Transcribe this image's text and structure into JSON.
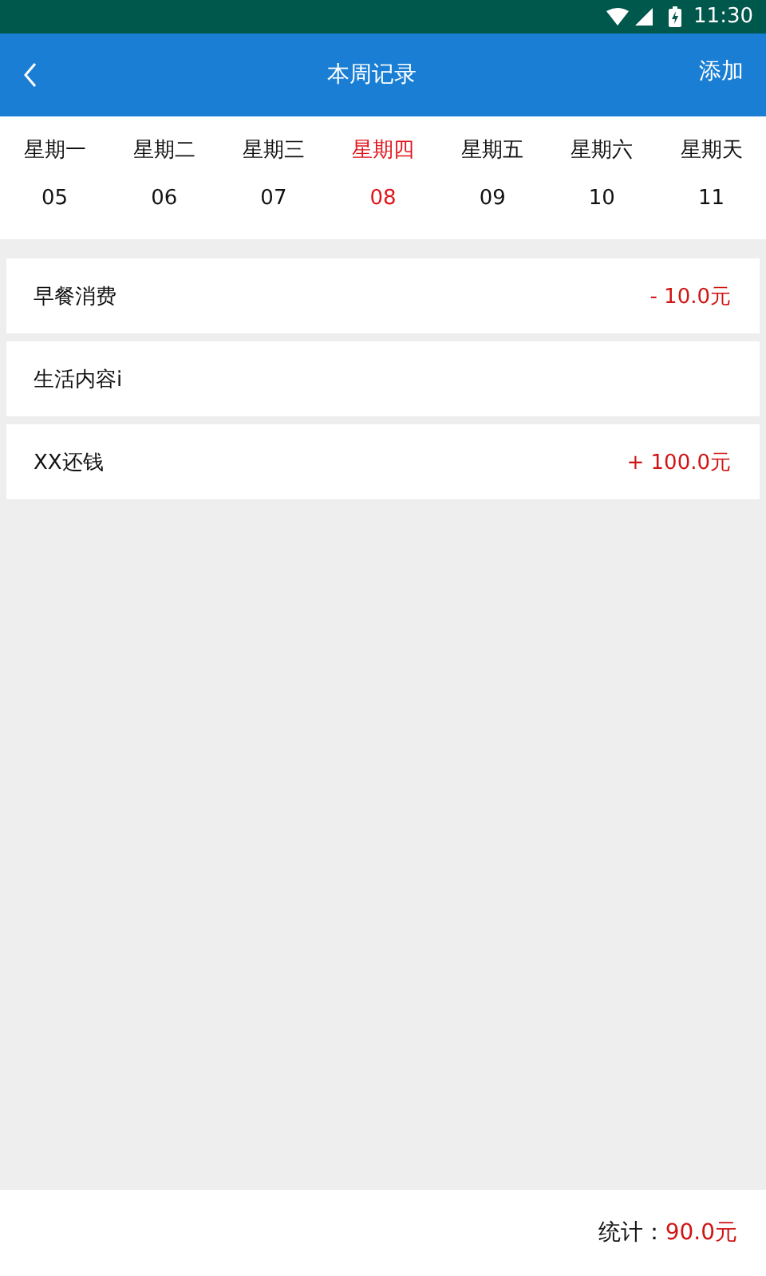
{
  "status_bar": {
    "time": "11:30"
  },
  "header": {
    "title": "本周记录",
    "action": "添加"
  },
  "days": [
    {
      "weekday": "星期一",
      "date": "05",
      "selected": false
    },
    {
      "weekday": "星期二",
      "date": "06",
      "selected": false
    },
    {
      "weekday": "星期三",
      "date": "07",
      "selected": false
    },
    {
      "weekday": "星期四",
      "date": "08",
      "selected": true
    },
    {
      "weekday": "星期五",
      "date": "09",
      "selected": false
    },
    {
      "weekday": "星期六",
      "date": "10",
      "selected": false
    },
    {
      "weekday": "星期天",
      "date": "11",
      "selected": false
    }
  ],
  "records": [
    {
      "title": "早餐消费",
      "amount": "- 10.0元"
    },
    {
      "title": "生活内容i"
    },
    {
      "title": "XX还钱",
      "amount": "+ 100.0元"
    }
  ],
  "footer": {
    "label": "统计：",
    "total": "90.0元"
  }
}
